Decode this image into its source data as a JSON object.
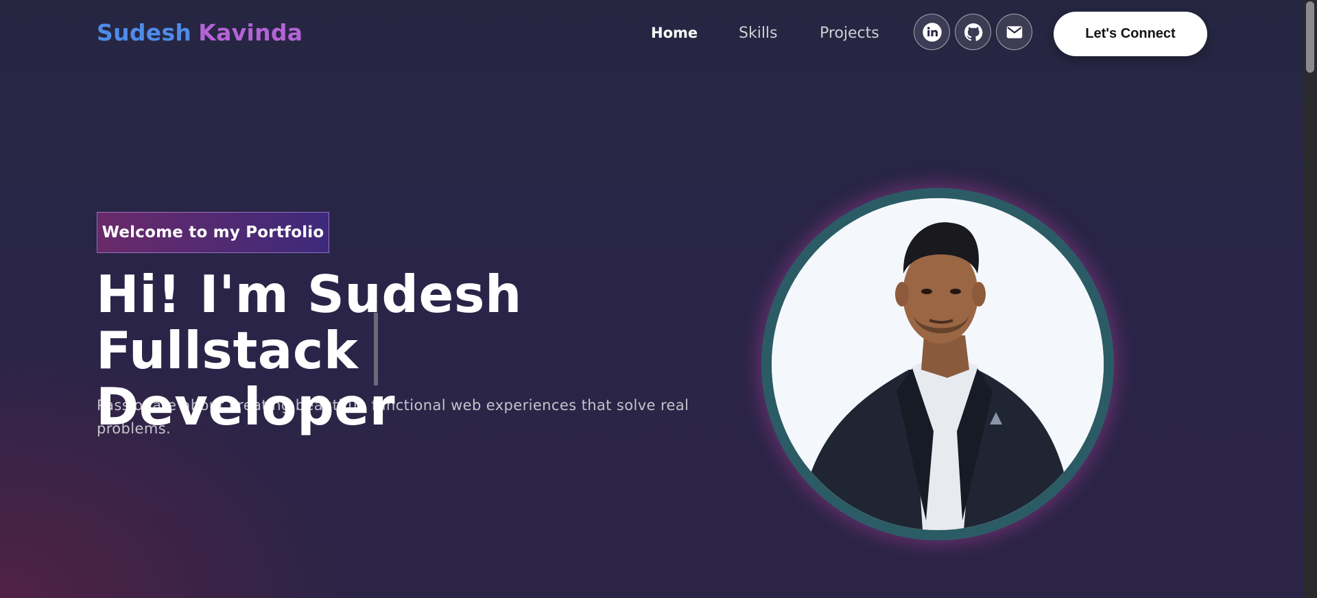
{
  "brand": {
    "first_name": "Sudesh",
    "last_name": "Kavinda"
  },
  "nav": {
    "links": [
      {
        "label": "Home",
        "active": true
      },
      {
        "label": "Skills",
        "active": false
      },
      {
        "label": "Projects",
        "active": false
      }
    ],
    "social": [
      {
        "icon": "linkedin-icon"
      },
      {
        "icon": "github-icon"
      },
      {
        "icon": "mail-icon"
      }
    ],
    "cta_label": "Let's Connect"
  },
  "hero": {
    "badge": "Welcome to my Portfolio",
    "headline_line1": "Hi! I'm Sudesh Fullstack",
    "headline_line2": "Developer",
    "tagline": "Passionate about creating beautiful, functional web experiences that solve real problems."
  },
  "profile": {
    "image": "profile-photo"
  },
  "colors": {
    "brand_first": "#4f8be8",
    "brand_last": "#b463d6",
    "background": "#2a2548",
    "ring": "#2b5c66",
    "glow": "#aa3c96"
  }
}
